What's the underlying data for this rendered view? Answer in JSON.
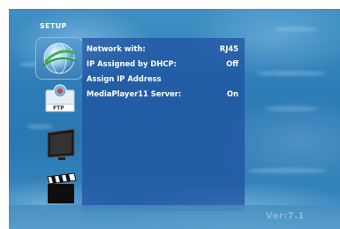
{
  "header": {
    "title": "SETUP"
  },
  "sidebar": {
    "items": [
      {
        "icon": "network-globe-icon",
        "selected": true
      },
      {
        "icon": "ftp-icon",
        "selected": false,
        "text": "FTP"
      },
      {
        "icon": "tv-display-icon",
        "selected": false
      },
      {
        "icon": "clapperboard-icon",
        "selected": false
      }
    ]
  },
  "settings": {
    "rows": [
      {
        "label": "Network with:",
        "value": "RJ45"
      },
      {
        "label": "IP Assigned by DHCP:",
        "value": "Off"
      },
      {
        "label": "Assign IP Address",
        "value": ""
      },
      {
        "label": "MediaPlayer11 Server:",
        "value": "On"
      }
    ]
  },
  "footer": {
    "version": "Ver:7.1"
  },
  "colors": {
    "panel": "#1e50a0",
    "text": "#ffffff",
    "water": "#2f7db6"
  }
}
